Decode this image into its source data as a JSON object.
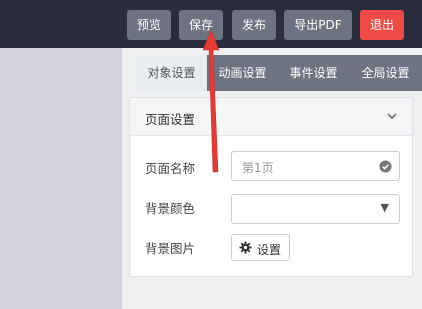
{
  "toolbar": {
    "preview_label": "预览",
    "save_label": "保存",
    "publish_label": "发布",
    "export_pdf_label": "导出PDF",
    "exit_label": "退出"
  },
  "tabs": [
    {
      "label": "对象设置",
      "active": true
    },
    {
      "label": "动画设置",
      "active": false
    },
    {
      "label": "事件设置",
      "active": false
    },
    {
      "label": "全局设置",
      "active": false
    }
  ],
  "page_settings": {
    "title": "页面设置",
    "name_label": "页面名称",
    "name_placeholder": "第1页",
    "bg_color_label": "背景颜色",
    "bg_color_value": "",
    "bg_image_label": "背景图片",
    "bg_image_button": "设置"
  },
  "colors": {
    "topbar": "#2a2d3d",
    "button_gray": "#6d7381",
    "button_danger": "#ef4b44",
    "arrow": "#e83a35"
  },
  "icons": [
    "chevron-down-icon",
    "check-circle-icon",
    "caret-down-icon",
    "gear-icon"
  ]
}
